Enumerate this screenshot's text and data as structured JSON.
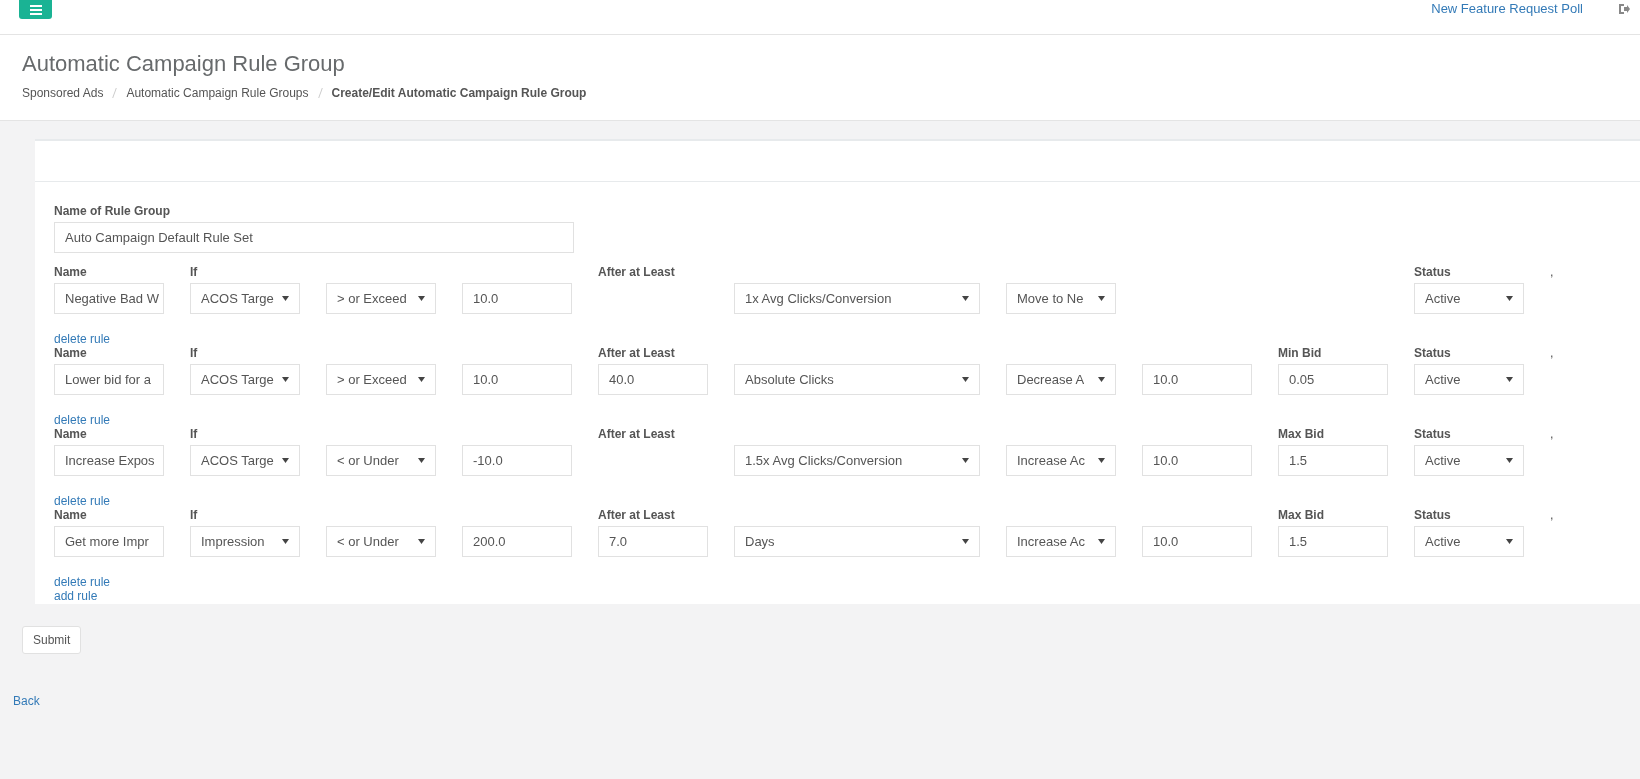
{
  "topbar": {
    "link": "New Feature Request Poll"
  },
  "header": {
    "title": "Automatic Campaign Rule Group",
    "breadcrumbs": [
      {
        "label": "Sponsored Ads",
        "current": false
      },
      {
        "label": "Automatic Campaign Rule Groups",
        "current": false
      },
      {
        "label": "Create/Edit Automatic Campaign Rule Group",
        "current": true
      }
    ]
  },
  "form": {
    "group_label": "Name of Rule Group",
    "group_name": "Auto Campaign Default Rule Set",
    "rules": [
      {
        "name_label": "Name",
        "name": "Negative Bad W",
        "if_label": "If",
        "metric": "ACOS Targe",
        "operator": "> or Exceed",
        "threshold": "10.0",
        "after_label": "After at Least",
        "basis": "1x Avg Clicks/Conversion",
        "action": "Move to Ne",
        "status_label": "Status",
        "status": "Active",
        "trailing_mark": ",",
        "delete_link": "delete rule"
      },
      {
        "name_label": "Name",
        "name": "Lower bid for a",
        "if_label": "If",
        "metric": "ACOS Targe",
        "operator": "> or Exceed",
        "threshold": "10.0",
        "after_label": "After at Least",
        "after": "40.0",
        "basis": "Absolute Clicks",
        "action": "Decrease A",
        "amount": "10.0",
        "bid_label": "Min Bid",
        "bid": "0.05",
        "status_label": "Status",
        "status": "Active",
        "trailing_mark": ",",
        "delete_link": "delete rule"
      },
      {
        "name_label": "Name",
        "name": "Increase Expos",
        "if_label": "If",
        "metric": "ACOS Targe",
        "operator": "< or Under",
        "threshold": "-10.0",
        "after_label": "After at Least",
        "basis": "1.5x Avg Clicks/Conversion",
        "action": "Increase Ac",
        "amount": "10.0",
        "bid_label": "Max Bid",
        "bid": "1.5",
        "status_label": "Status",
        "status": "Active",
        "trailing_mark": ",",
        "delete_link": "delete rule"
      },
      {
        "name_label": "Name",
        "name": "Get more Impr",
        "if_label": "If",
        "metric": "Impression",
        "operator": "< or Under",
        "threshold": "200.0",
        "after_label": "After at Least",
        "after": "7.0",
        "basis": "Days",
        "action": "Increase Ac",
        "amount": "10.0",
        "bid_label": "Max Bid",
        "bid": "1.5",
        "status_label": "Status",
        "status": "Active",
        "trailing_mark": ",",
        "delete_link": "delete rule"
      }
    ],
    "add_link": "add rule"
  },
  "submit": "Submit",
  "back": "Back"
}
